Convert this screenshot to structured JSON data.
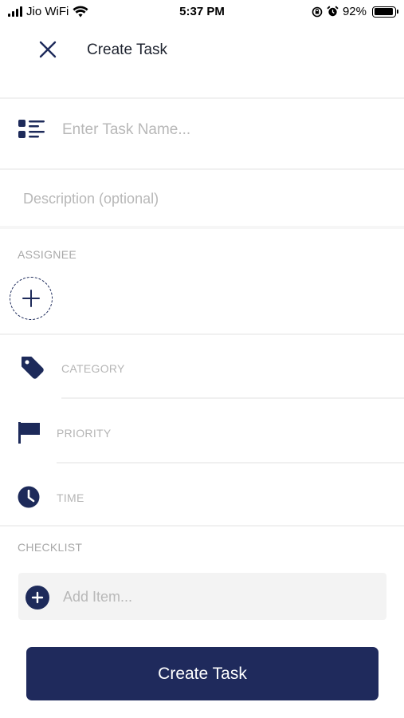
{
  "status_bar": {
    "carrier": "Jio WiFi",
    "time": "5:37 PM",
    "battery_percent": "92%",
    "battery_level": 0.92,
    "icons": [
      "signal-icon",
      "wifi-icon",
      "rotation-lock-icon",
      "alarm-icon",
      "battery-icon"
    ]
  },
  "header": {
    "title": "Create Task",
    "close_icon": "close-icon"
  },
  "task_name": {
    "placeholder": "Enter Task Name...",
    "value": "",
    "icon": "task-list-icon"
  },
  "description": {
    "placeholder": "Description (optional)",
    "value": ""
  },
  "assignee": {
    "label": "ASSIGNEE",
    "add_icon": "add-assignee-icon"
  },
  "properties": [
    {
      "label": "CATEGORY",
      "icon": "tag-icon"
    },
    {
      "label": "PRIORITY",
      "icon": "flag-icon"
    },
    {
      "label": "TIME",
      "icon": "clock-icon"
    }
  ],
  "checklist": {
    "label": "CHECKLIST",
    "placeholder": "Add Item...",
    "value": "",
    "add_icon": "plus-circle-icon"
  },
  "submit": {
    "label": "Create Task"
  },
  "colors": {
    "primary": "#1f2a5c",
    "placeholder": "#b8b8b8",
    "divider": "#f1f1f1",
    "field_background": "#f3f3f3"
  }
}
